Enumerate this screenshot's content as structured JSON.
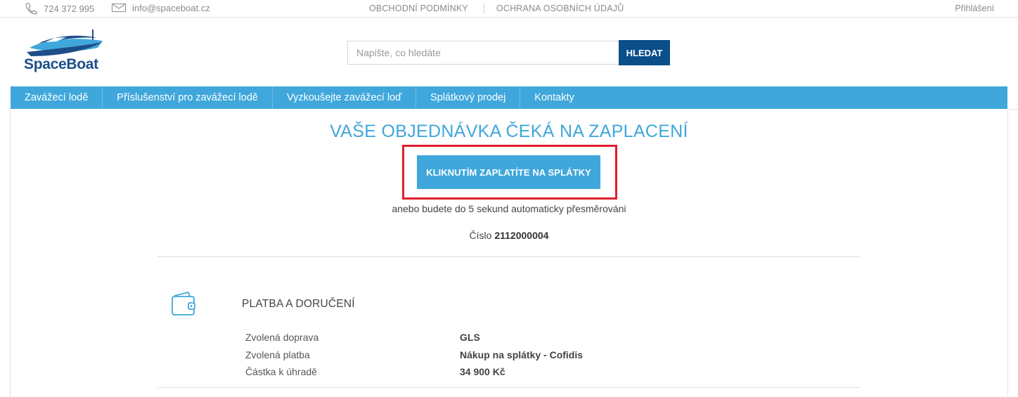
{
  "topbar": {
    "phone": "724 372 995",
    "email": "info@spaceboat.cz",
    "links": [
      "OBCHODNÍ PODMÍNKY",
      "OCHRANA OSOBNÍCH ÚDAJŮ"
    ],
    "login": "Přihlášení"
  },
  "logo": {
    "text": "SpaceBoat"
  },
  "search": {
    "placeholder": "Napište, co hledáte",
    "button": "HLEDAT"
  },
  "nav": [
    "Zavážecí lodě",
    "Příslušenství pro zavážecí lodě",
    "Vyzkoušejte zavážecí loď",
    "Splátkový prodej",
    "Kontakty"
  ],
  "main": {
    "title": "VAŠE OBJEDNÁVKA ČEKÁ NA ZAPLACENÍ",
    "pay_button": "KLIKNUTÍM ZAPLATÍTE NA SPLÁTKY",
    "redirect_text": "anebo budete do 5 sekund automaticky přesměrováni",
    "order_label": "Číslo",
    "order_number": "2112000004"
  },
  "payment": {
    "section_title": "PLATBA A DORUČENÍ",
    "rows": [
      {
        "label": "Zvolená doprava",
        "value": "GLS"
      },
      {
        "label": "Zvolená platba",
        "value": "Nákup na splátky - Cofidis"
      },
      {
        "label": "Částka k úhradě",
        "value": "34 900 Kč"
      }
    ]
  },
  "colors": {
    "accent": "#3fa7db",
    "dark_blue": "#0b4f8a",
    "highlight": "#e01e2b"
  },
  "icons": [
    "phone-icon",
    "mail-icon",
    "wallet-icon",
    "boat-logo-icon"
  ]
}
